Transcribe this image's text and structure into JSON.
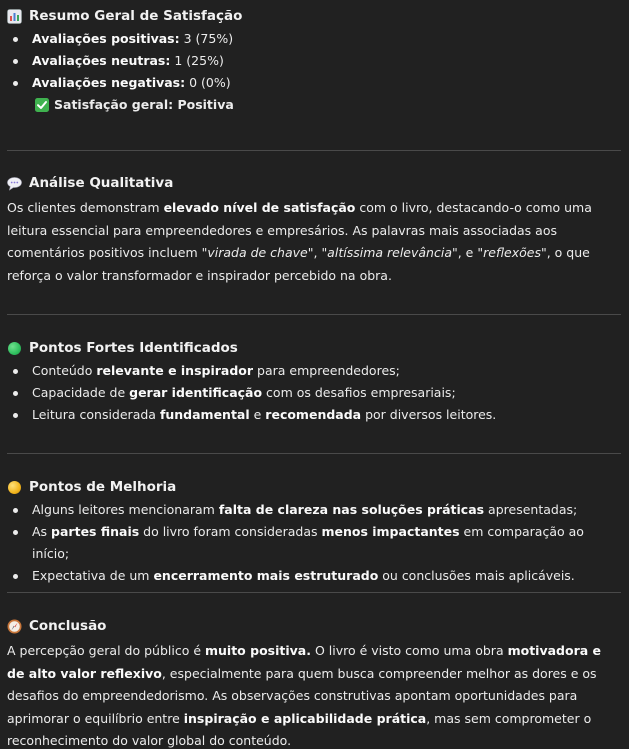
{
  "summary": {
    "title": "Resumo Geral de Satisfação",
    "items": [
      {
        "label": "Avaliações positivas:",
        "value": "3 (75%)"
      },
      {
        "label": "Avaliações neutras:",
        "value": "1 (25%)"
      },
      {
        "label": "Avaliações negativas:",
        "value": "0 (0%)"
      }
    ],
    "overall": "Satisfação geral: Positiva"
  },
  "qualitative": {
    "title": "Análise Qualitativa",
    "p1": "Os clientes demonstram ",
    "b1": "elevado nível de satisfação",
    "p2": " com o livro, destacando-o como uma leitura essencial para empreendedores e empresários. As palavras mais associadas aos comentários positivos incluem ",
    "q1": "\"virada de chave\"",
    "p3": ", ",
    "q2": "\"altíssima relevância\"",
    "p4": ", e ",
    "q3": "\"reflexões\"",
    "p5": ", o que reforça o valor transformador e inspirador percebido na obra."
  },
  "strengths": {
    "title": "Pontos Fortes Identificados",
    "items": [
      {
        "a": "Conteúdo ",
        "b": "relevante e inspirador",
        "c": " para empreendedores;"
      },
      {
        "a": "Capacidade de ",
        "b": "gerar identificação",
        "c": " com os desafios empresariais;"
      },
      {
        "a": "Leitura considerada ",
        "b": "fundamental",
        "c": " e ",
        "d": "recomendada",
        "e": " por diversos leitores."
      }
    ]
  },
  "improvements": {
    "title": "Pontos de Melhoria",
    "items": [
      {
        "a": "Alguns leitores mencionaram ",
        "b": "falta de clareza nas soluções práticas",
        "c": " apresentadas;"
      },
      {
        "a": "As ",
        "b": "partes finais",
        "c": " do livro foram consideradas ",
        "d": "menos impactantes",
        "e": " em comparação ao início;"
      },
      {
        "a": "Expectativa de um ",
        "b": "encerramento mais estruturado",
        "c": " ou conclusões mais aplicáveis."
      }
    ]
  },
  "conclusion": {
    "title": "Conclusão",
    "p1": "A percepção geral do público é ",
    "b1": "muito positiva.",
    "p2": " O livro é visto como uma obra ",
    "b2": "motivadora e de alto valor reflexivo",
    "p3": ", especialmente para quem busca compreender melhor as dores e os desafios do empreendedorismo. As observações construtivas apontam oportunidades para aprimorar o equilíbrio entre ",
    "b3": "inspiração e aplicabilidade prática",
    "p4": ", mas sem comprometer o reconhecimento do valor global do conteúdo."
  },
  "icons": {
    "summary": "bar-chart-icon",
    "qualitative": "speech-bubble-icon",
    "strengths": "green-circle-icon",
    "improvements": "yellow-circle-icon",
    "conclusion": "compass-icon",
    "check": "check-mark-icon"
  },
  "colors": {
    "background": "#212121",
    "text": "#ececec",
    "check": "#3fb24f",
    "green": "#2fbf5e",
    "yellow": "#f2b51d"
  }
}
